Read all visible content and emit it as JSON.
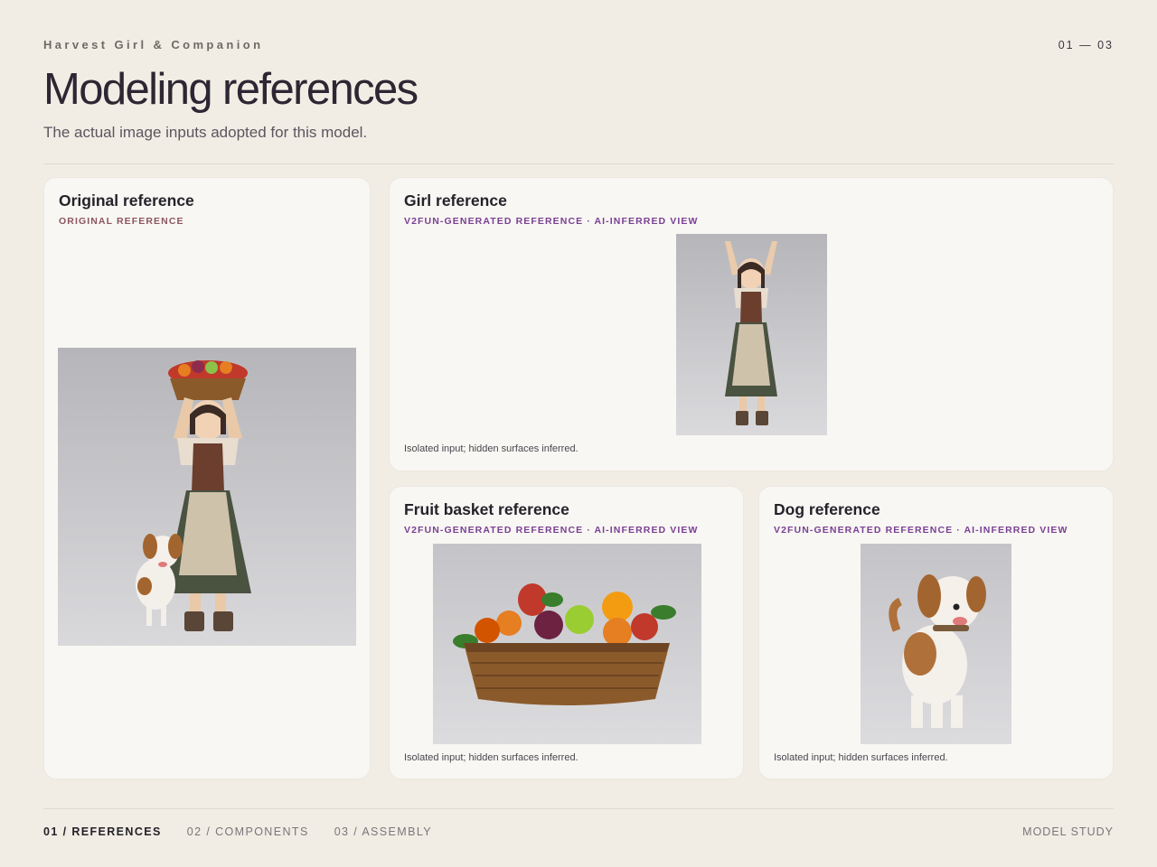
{
  "header": {
    "kicker": "Harvest Girl & Companion",
    "page_indicator": "01 — 03",
    "title": "Modeling references",
    "subtitle": "The actual image inputs adopted for this model."
  },
  "cards": {
    "original": {
      "title": "Original reference",
      "tag": "ORIGINAL REFERENCE"
    },
    "girl": {
      "title": "Girl reference",
      "tag": "V2FUN-GENERATED REFERENCE · AI-INFERRED VIEW",
      "note": "Isolated input; hidden surfaces inferred."
    },
    "basket": {
      "title": "Fruit basket reference",
      "tag": "V2FUN-GENERATED REFERENCE · AI-INFERRED VIEW",
      "note": "Isolated input; hidden surfaces inferred."
    },
    "dog": {
      "title": "Dog reference",
      "tag": "V2FUN-GENERATED REFERENCE · AI-INFERRED VIEW",
      "note": "Isolated input; hidden surfaces inferred."
    }
  },
  "footer": {
    "nav": [
      {
        "label": "01 / REFERENCES",
        "active": true
      },
      {
        "label": "02 / COMPONENTS",
        "active": false
      },
      {
        "label": "03 / ASSEMBLY",
        "active": false
      }
    ],
    "right_label": "MODEL STUDY"
  },
  "colors": {
    "background": "#f1ede4",
    "card": "#f8f7f3",
    "original_tag": "#8c5560",
    "generated_tag": "#7a3f94"
  }
}
